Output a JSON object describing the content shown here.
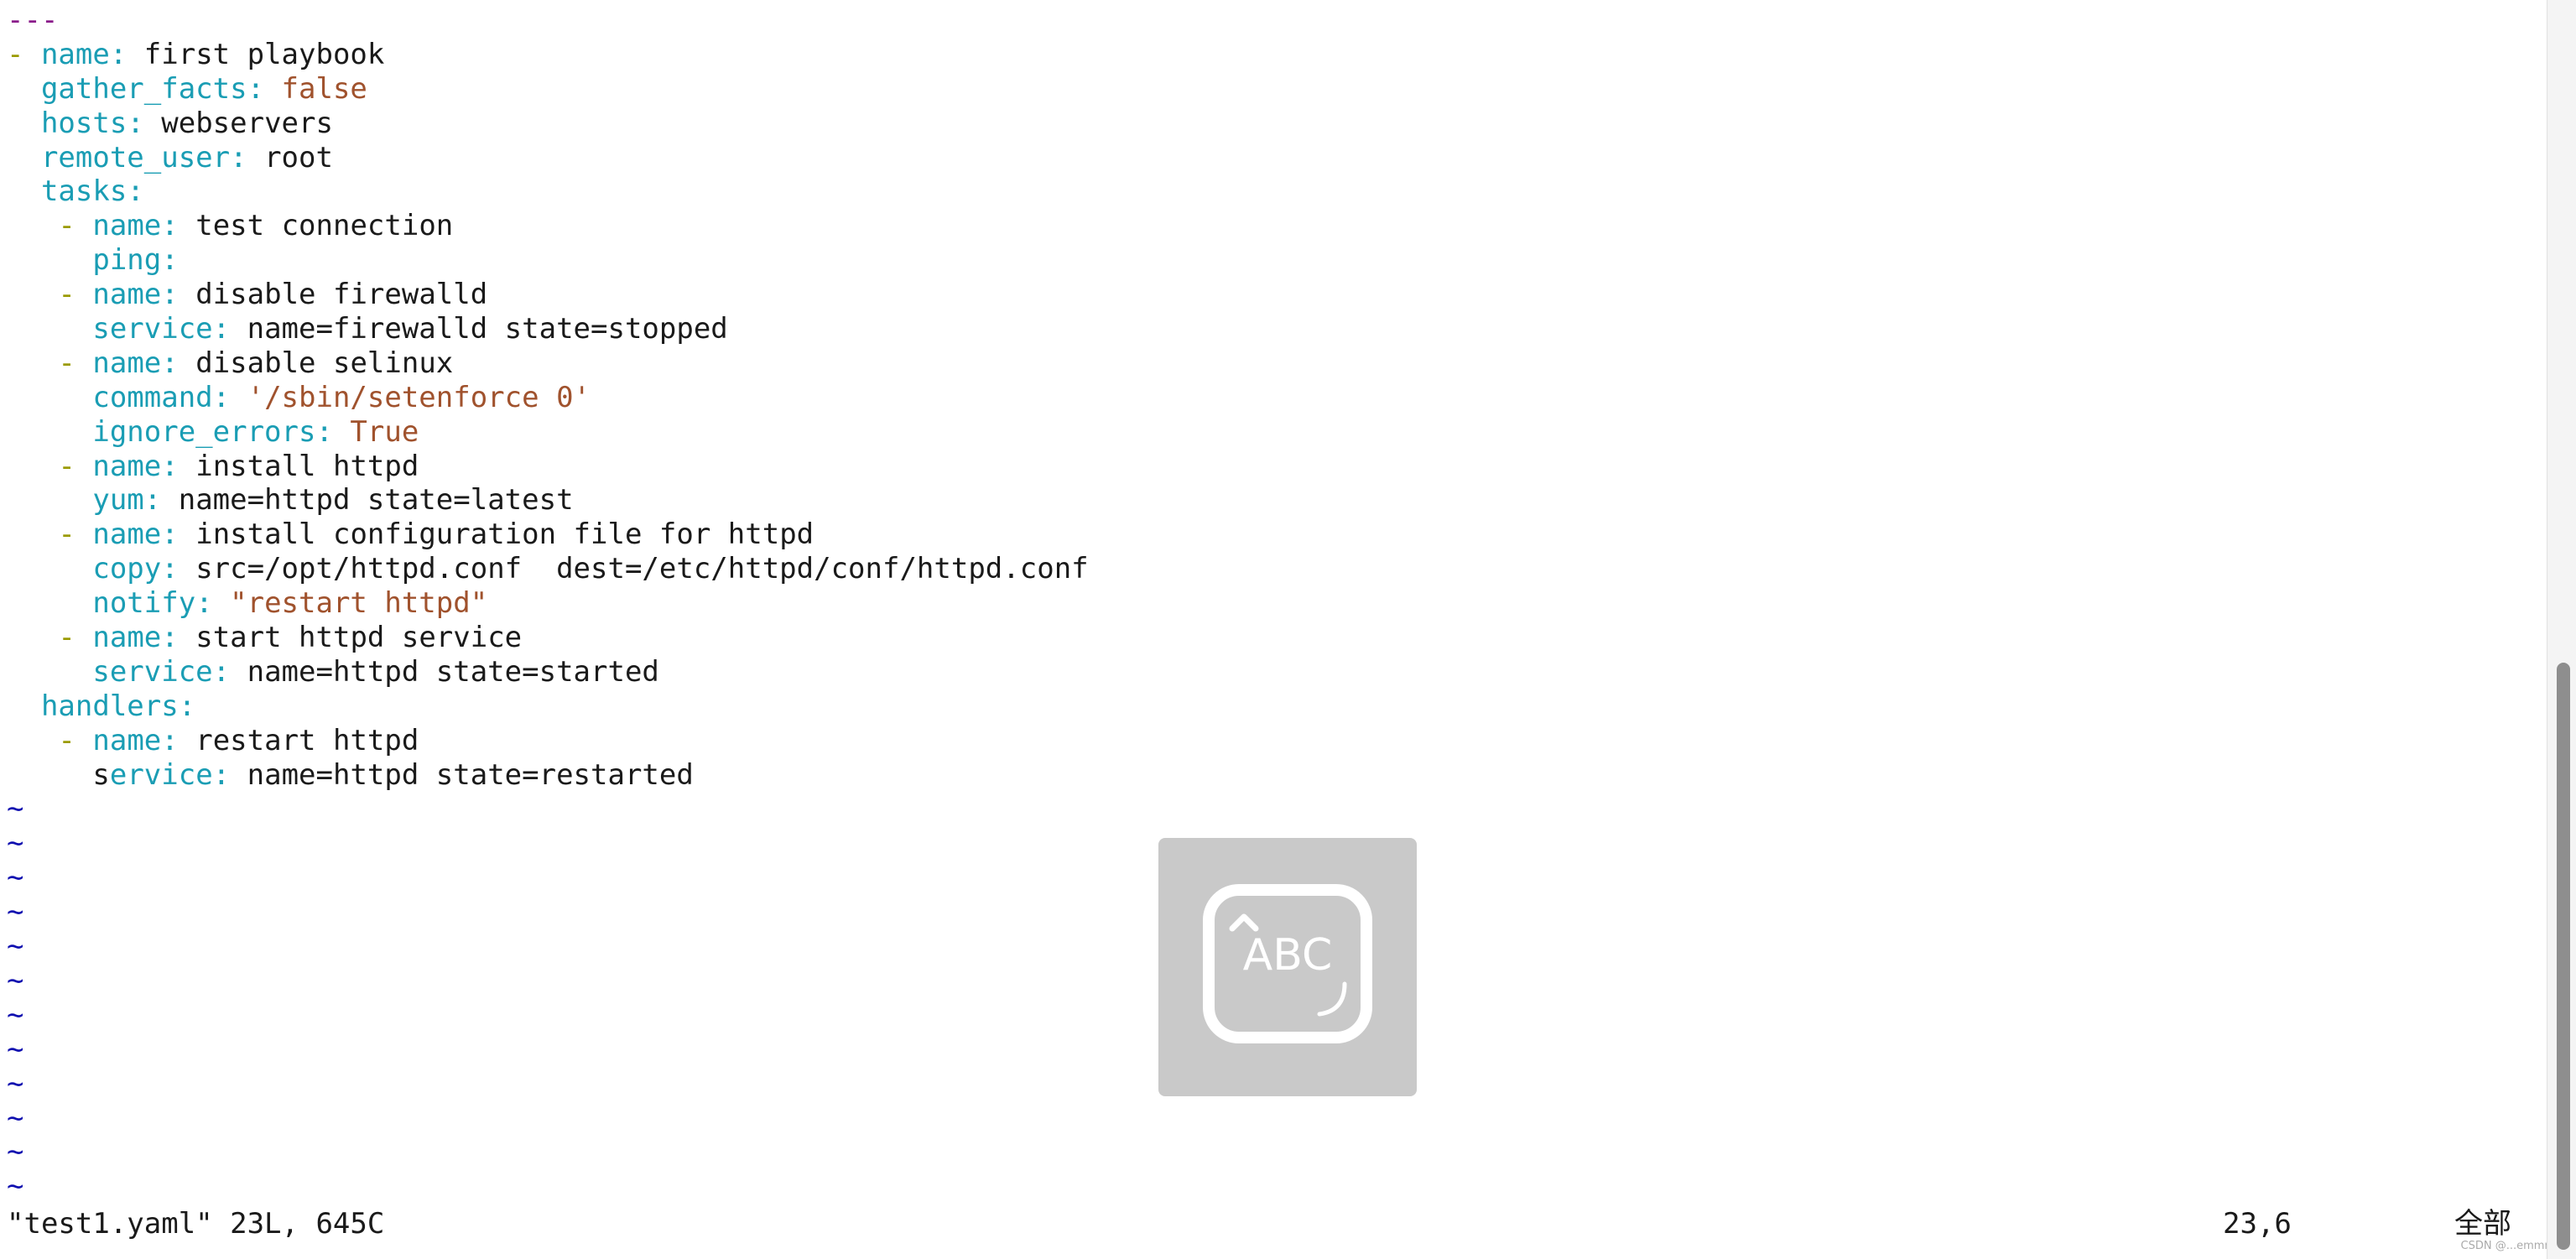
{
  "editor": {
    "lines": [
      [
        {
          "t": "---",
          "c": "doc"
        }
      ],
      [
        {
          "t": "- ",
          "c": "dash"
        },
        {
          "t": "name",
          "c": "key"
        },
        {
          "t": ": ",
          "c": "colon"
        },
        {
          "t": "first playbook",
          "c": "val"
        }
      ],
      [
        {
          "t": "  ",
          "c": "val"
        },
        {
          "t": "gather_facts",
          "c": "key"
        },
        {
          "t": ": ",
          "c": "colon"
        },
        {
          "t": "false",
          "c": "bool"
        }
      ],
      [
        {
          "t": "  ",
          "c": "val"
        },
        {
          "t": "hosts",
          "c": "key"
        },
        {
          "t": ": ",
          "c": "colon"
        },
        {
          "t": "webservers",
          "c": "val"
        }
      ],
      [
        {
          "t": "  ",
          "c": "val"
        },
        {
          "t": "remote_user",
          "c": "key"
        },
        {
          "t": ": ",
          "c": "colon"
        },
        {
          "t": "root",
          "c": "val"
        }
      ],
      [
        {
          "t": "  ",
          "c": "val"
        },
        {
          "t": "tasks",
          "c": "key"
        },
        {
          "t": ":",
          "c": "colon"
        }
      ],
      [
        {
          "t": "   ",
          "c": "val"
        },
        {
          "t": "- ",
          "c": "dash"
        },
        {
          "t": "name",
          "c": "key"
        },
        {
          "t": ": ",
          "c": "colon"
        },
        {
          "t": "test connection",
          "c": "val"
        }
      ],
      [
        {
          "t": "     ",
          "c": "val"
        },
        {
          "t": "ping",
          "c": "key"
        },
        {
          "t": ":",
          "c": "colon"
        }
      ],
      [
        {
          "t": "   ",
          "c": "val"
        },
        {
          "t": "- ",
          "c": "dash"
        },
        {
          "t": "name",
          "c": "key"
        },
        {
          "t": ": ",
          "c": "colon"
        },
        {
          "t": "disable firewalld",
          "c": "val"
        }
      ],
      [
        {
          "t": "     ",
          "c": "val"
        },
        {
          "t": "service",
          "c": "key"
        },
        {
          "t": ": ",
          "c": "colon"
        },
        {
          "t": "name=firewalld state=stopped",
          "c": "val"
        }
      ],
      [
        {
          "t": "   ",
          "c": "val"
        },
        {
          "t": "- ",
          "c": "dash"
        },
        {
          "t": "name",
          "c": "key"
        },
        {
          "t": ": ",
          "c": "colon"
        },
        {
          "t": "disable selinux",
          "c": "val"
        }
      ],
      [
        {
          "t": "     ",
          "c": "val"
        },
        {
          "t": "command",
          "c": "key"
        },
        {
          "t": ": ",
          "c": "colon"
        },
        {
          "t": "'/sbin/setenforce 0'",
          "c": "str"
        }
      ],
      [
        {
          "t": "     ",
          "c": "val"
        },
        {
          "t": "ignore_errors",
          "c": "key"
        },
        {
          "t": ": ",
          "c": "colon"
        },
        {
          "t": "True",
          "c": "bool"
        }
      ],
      [
        {
          "t": "   ",
          "c": "val"
        },
        {
          "t": "- ",
          "c": "dash"
        },
        {
          "t": "name",
          "c": "key"
        },
        {
          "t": ": ",
          "c": "colon"
        },
        {
          "t": "install httpd",
          "c": "val"
        }
      ],
      [
        {
          "t": "     ",
          "c": "val"
        },
        {
          "t": "yum",
          "c": "key"
        },
        {
          "t": ": ",
          "c": "colon"
        },
        {
          "t": "name=httpd state=latest",
          "c": "val"
        }
      ],
      [
        {
          "t": "   ",
          "c": "val"
        },
        {
          "t": "- ",
          "c": "dash"
        },
        {
          "t": "name",
          "c": "key"
        },
        {
          "t": ": ",
          "c": "colon"
        },
        {
          "t": "install configuration file for httpd",
          "c": "val"
        }
      ],
      [
        {
          "t": "     ",
          "c": "val"
        },
        {
          "t": "copy",
          "c": "key"
        },
        {
          "t": ": ",
          "c": "colon"
        },
        {
          "t": "src=/opt/httpd.conf  dest=/etc/httpd/conf/httpd.conf",
          "c": "val"
        }
      ],
      [
        {
          "t": "     ",
          "c": "val"
        },
        {
          "t": "notify",
          "c": "key"
        },
        {
          "t": ": ",
          "c": "colon"
        },
        {
          "t": "\"restart httpd\"",
          "c": "str"
        }
      ],
      [
        {
          "t": "   ",
          "c": "val"
        },
        {
          "t": "- ",
          "c": "dash"
        },
        {
          "t": "name",
          "c": "key"
        },
        {
          "t": ": ",
          "c": "colon"
        },
        {
          "t": "start httpd service",
          "c": "val"
        }
      ],
      [
        {
          "t": "     ",
          "c": "val"
        },
        {
          "t": "service",
          "c": "key"
        },
        {
          "t": ": ",
          "c": "colon"
        },
        {
          "t": "name=httpd state=started",
          "c": "val"
        }
      ],
      [
        {
          "t": "  ",
          "c": "val"
        },
        {
          "t": "handlers",
          "c": "key"
        },
        {
          "t": ":",
          "c": "colon"
        }
      ],
      [
        {
          "t": "   ",
          "c": "val"
        },
        {
          "t": "- ",
          "c": "dash"
        },
        {
          "t": "name",
          "c": "key"
        },
        {
          "t": ": ",
          "c": "colon"
        },
        {
          "t": "restart httpd",
          "c": "val"
        }
      ],
      [
        {
          "t": "     ",
          "c": "val"
        },
        {
          "t": "s",
          "c": "cursor"
        },
        {
          "t": "ervice",
          "c": "key"
        },
        {
          "t": ": ",
          "c": "colon"
        },
        {
          "t": "name=httpd state=restarted",
          "c": "val"
        }
      ]
    ],
    "empty_line_marker": "~",
    "empty_line_count": 12
  },
  "status_bar": {
    "file_info": "\"test1.yaml\" 23L, 645C",
    "cursor_position": "23,6",
    "scroll_indicator": "全部"
  },
  "ime_overlay": {
    "label": "ABC",
    "icon": "keyboard-abc-icon"
  },
  "watermark": "CSDN @...emmm?",
  "colors": {
    "key": "#1a9db4",
    "dash": "#9a9a00",
    "string": "#a0522d",
    "cursor": "#22ee22",
    "tilde": "#1010b0",
    "doc_marker": "#8a1b8a"
  }
}
